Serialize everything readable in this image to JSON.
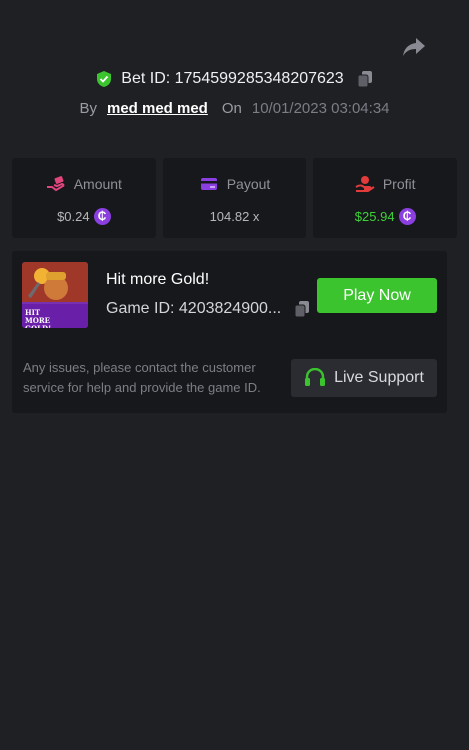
{
  "header": {
    "bet_id_label": "Bet ID: 1754599285348207623",
    "by_label": "By",
    "username": "med med med",
    "on_label": "On",
    "date": "10/01/2023 03:04:34"
  },
  "stats": {
    "amount": {
      "label": "Amount",
      "value": "$0.24",
      "icon": "bet-hand-icon",
      "color": "#e0457b"
    },
    "payout": {
      "label": "Payout",
      "value": "104.82 x",
      "icon": "card-icon",
      "color": "#8b3fe0"
    },
    "profit": {
      "label": "Profit",
      "value": "$25.94",
      "icon": "profit-hand-icon",
      "color": "#e23b3b"
    }
  },
  "coin_symbol": "₵",
  "game": {
    "title": "Hit more Gold!",
    "id_label": "Game ID: 4203824900...",
    "thumbnail_text": "HIT MORE GOLD!",
    "play_label": "Play Now"
  },
  "support": {
    "message": "Any issues, please contact the customer service for help and provide the game ID.",
    "button_label": "Live Support"
  },
  "colors": {
    "background": "#1f2024",
    "card": "#17181b",
    "accent_green": "#3cc42f",
    "profit_green": "#3fd13a",
    "coin_purple": "#8b3fe0"
  }
}
